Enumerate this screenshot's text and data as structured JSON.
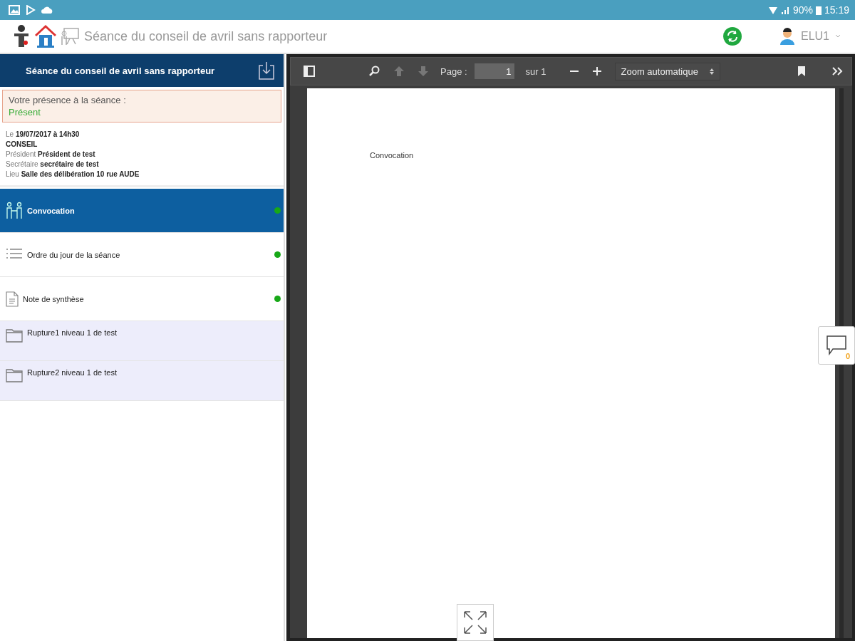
{
  "status_bar": {
    "battery": "90%",
    "time": "15:19"
  },
  "header": {
    "title": "Séance du conseil de avril sans rapporteur",
    "user": "ELU1"
  },
  "session": {
    "title": "Séance du conseil de avril sans rapporteur",
    "presence_label": "Votre présence à la séance :",
    "presence_value": "Présent",
    "details": [
      {
        "label": "Le",
        "value": "19/07/2017 à 14h30"
      },
      {
        "value": "CONSEIL"
      },
      {
        "label": "Président",
        "value": "Président de test"
      },
      {
        "label": "Secrétaire",
        "value": "secrétaire de test"
      },
      {
        "label": "Lieu",
        "value": "Salle des délibération 10 rue AUDE"
      }
    ]
  },
  "documents": [
    {
      "kind": "convocation",
      "label": "Convocation",
      "selected": true,
      "dot": true
    },
    {
      "kind": "agenda",
      "label": "Ordre du jour de la séance",
      "selected": false,
      "dot": true
    },
    {
      "kind": "note",
      "label": "Note de synthèse",
      "selected": false,
      "dot": true
    },
    {
      "kind": "folder",
      "label": "Rupture1 niveau 1 de test",
      "selected": false,
      "dot": false
    },
    {
      "kind": "folder",
      "label": "Rupture2 niveau 1 de test",
      "selected": false,
      "dot": false
    }
  ],
  "viewer": {
    "page_label": "Page :",
    "page": "1",
    "page_total": "sur 1",
    "zoom": "Zoom automatique",
    "document_text": "Convocation",
    "comment_count": "0"
  }
}
